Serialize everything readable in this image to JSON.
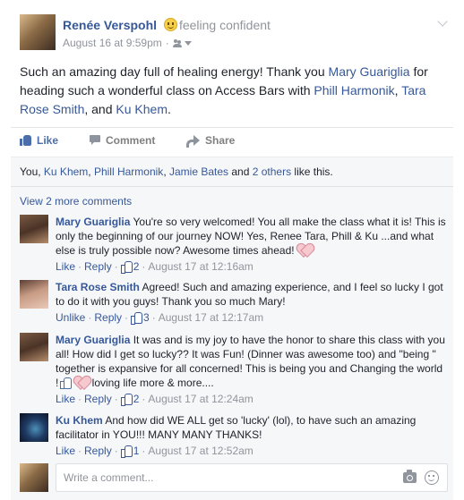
{
  "post": {
    "author": "Renée Verspohl",
    "feeling": "feeling confident",
    "timestamp": "August 16 at 9:59pm",
    "meta_separator": "·",
    "text_parts": [
      "Such an amazing day full of healing energy! Thank you ",
      "Mary Guariglia",
      " for heading such a wonderful class on Access Bars with ",
      "Phill Harmonik",
      ", ",
      "Tara Rose Smith",
      ", and ",
      "Ku Khem",
      "."
    ]
  },
  "actions": {
    "like": "Like",
    "comment": "Comment",
    "share": "Share"
  },
  "reactions": {
    "prefix": "You, ",
    "names": [
      "Ku Khem",
      "Phill Harmonik",
      "Jamie Bates"
    ],
    "sep1": ", ",
    "sep2": ", ",
    "and": " and ",
    "others": "2 others",
    "suffix": " like this."
  },
  "view_more_comments": "View 2 more comments",
  "comments": [
    {
      "author": "Mary Guariglia",
      "text": "You're so very welcomed! You all make the class what it is! This is only the beginning of our journey NOW! Yes, Renee Tara, Phill & Ku ...and what else is truly possible now? Awesome times ahead!",
      "like_label": "Like",
      "reply_label": "Reply",
      "like_count": "2",
      "time": "August 17 at 12:16am",
      "sep": "·"
    },
    {
      "author": "Tara Rose Smith",
      "text": "Agreed! Such and amazing experience, and I feel so lucky I got to do it with you guys! Thank you so much Mary!",
      "like_label": "Unlike",
      "reply_label": "Reply",
      "like_count": "3",
      "time": "August 17 at 12:17am",
      "sep": "·"
    },
    {
      "author": "Mary Guariglia",
      "text_before": "It was and is my joy to have the honor to share this class with you all! How did I get so lucky?? It was Fun! (Dinner was awesome too) and \"being \" together is expansive for all concerned! This is being you and Changing the world !",
      "text_after": " loving life more & more....",
      "like_label": "Like",
      "reply_label": "Reply",
      "like_count": "2",
      "time": "August 17 at 12:24am",
      "sep": "·"
    },
    {
      "author": "Ku Khem",
      "text": "And how did WE ALL get so 'lucky' (lol), to have such an amazing facilitator in YOU!!! MANY MANY THANKS!",
      "like_label": "Like",
      "reply_label": "Reply",
      "like_count": "1",
      "time": "August 17 at 12:52am",
      "sep": "·"
    }
  ],
  "composer": {
    "placeholder": "Write a comment..."
  },
  "colors": {
    "link": "#365899",
    "meta": "#90949c",
    "panel": "#f6f7f9"
  }
}
